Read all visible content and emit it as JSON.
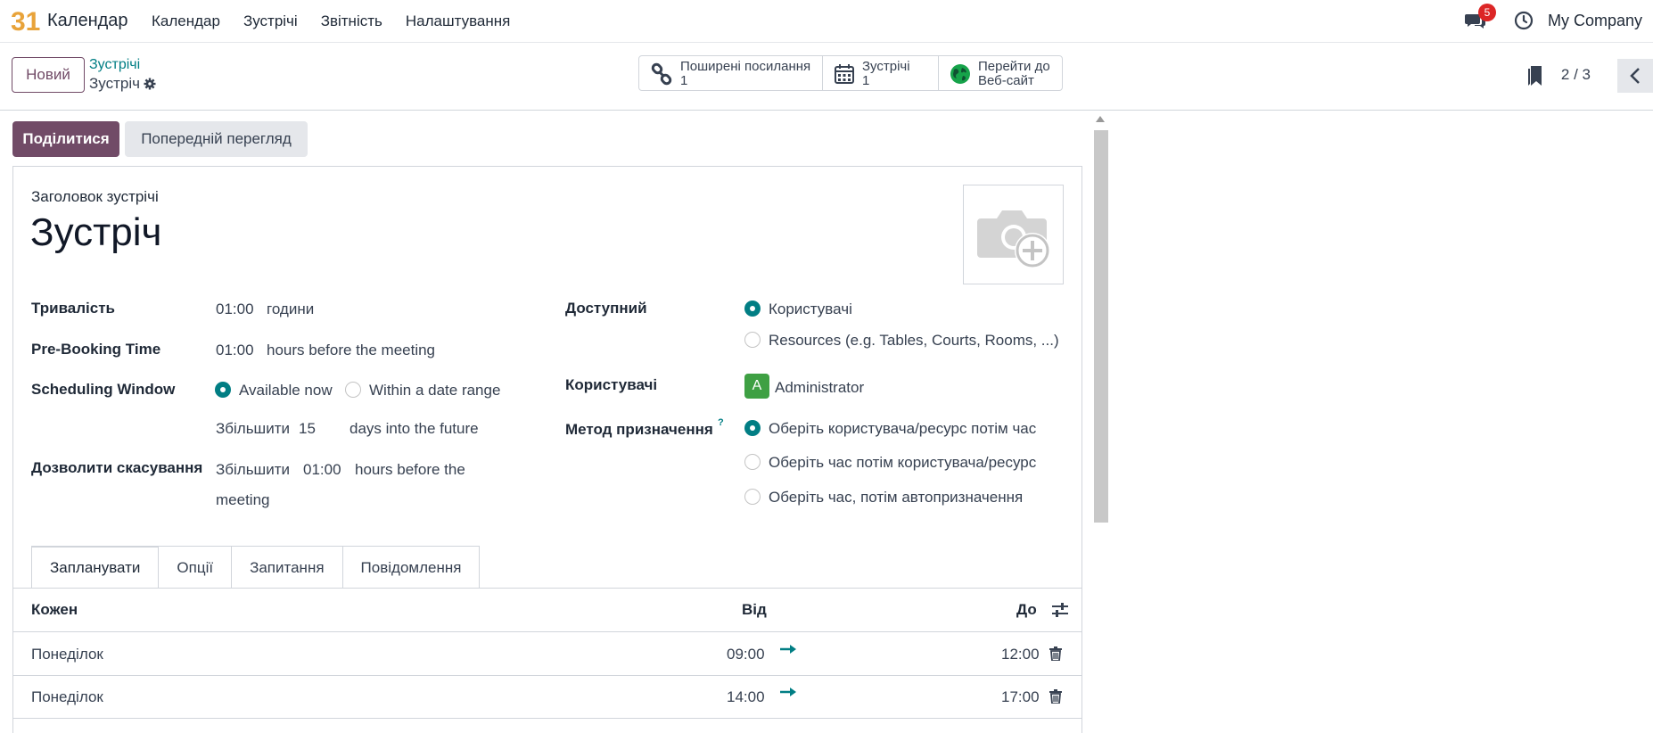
{
  "app": {
    "logo_text": "31",
    "name": "Календар",
    "menu": [
      "Календар",
      "Зустрічі",
      "Звітність",
      "Налаштування"
    ],
    "chat_badge": "5",
    "company": "My Company"
  },
  "control": {
    "new_label": "Новий",
    "breadcrumb_parent": "Зустрічі",
    "breadcrumb_current": "Зустріч",
    "smart_buttons": [
      {
        "label": "Поширені посилання",
        "value": "1"
      },
      {
        "label": "Зустрічі",
        "value": "1"
      },
      {
        "label": "Перейти до",
        "value": "Веб-сайт"
      }
    ],
    "pager": "2 / 3"
  },
  "actions": {
    "share": "Поділитися",
    "preview": "Попередній перегляд"
  },
  "form": {
    "title_label": "Заголовок зустрічі",
    "title": "Зустріч",
    "duration_label": "Тривалість",
    "duration_value": "01:00",
    "duration_unit": "години",
    "prebooking_label": "Pre-Booking Time",
    "prebooking_value": "01:00",
    "prebooking_unit": "hours before the meeting",
    "window_label": "Scheduling Window",
    "window_opt1": "Available now",
    "window_opt2": "Within a date range",
    "increase_word": "Збільшити",
    "window_days": "15",
    "window_unit": "days into the future",
    "cancel_label": "Дозволити скасування",
    "cancel_value": "01:00",
    "cancel_unit_1": "hours before the",
    "cancel_unit_2": "meeting",
    "available_label": "Доступний",
    "available_opt1": "Користувачі",
    "available_opt2": "Resources (e.g. Tables, Courts, Rooms, ...)",
    "users_label": "Користувачі",
    "user_initial": "A",
    "user_name": "Administrator",
    "assign_label": "Метод призначення",
    "assign_help": "?",
    "assign_opt1": "Оберіть користувача/ресурс потім час",
    "assign_opt2": "Оберіть час потім користувача/ресурс",
    "assign_opt3": "Оберіть час, потім автопризначення"
  },
  "tabs": [
    "Запланувати",
    "Опції",
    "Запитання",
    "Повідомлення"
  ],
  "table": {
    "headers": {
      "every": "Кожен",
      "from": "Від",
      "to": "До"
    },
    "rows": [
      {
        "day": "Понеділок",
        "from": "09:00",
        "to": "12:00"
      },
      {
        "day": "Понеділок",
        "from": "14:00",
        "to": "17:00"
      }
    ]
  }
}
